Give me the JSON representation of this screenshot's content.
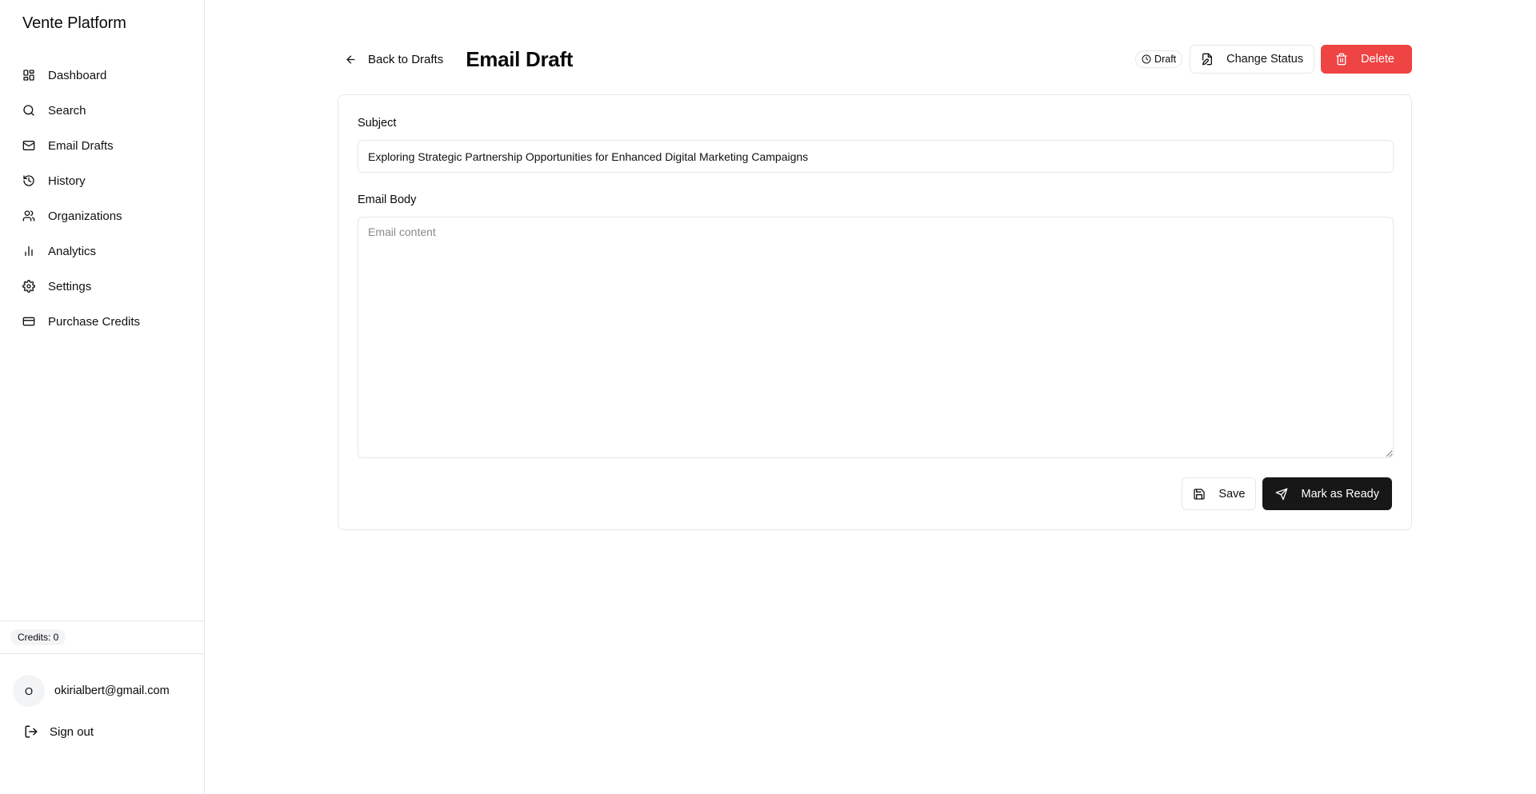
{
  "sidebar": {
    "brand": "Vente Platform",
    "items": [
      {
        "label": "Dashboard",
        "icon": "dashboard-icon"
      },
      {
        "label": "Search",
        "icon": "search-icon"
      },
      {
        "label": "Email Drafts",
        "icon": "mail-icon"
      },
      {
        "label": "History",
        "icon": "history-icon"
      },
      {
        "label": "Organizations",
        "icon": "users-icon"
      },
      {
        "label": "Analytics",
        "icon": "bar-chart-icon"
      },
      {
        "label": "Settings",
        "icon": "gear-icon"
      },
      {
        "label": "Purchase Credits",
        "icon": "credit-card-icon"
      }
    ],
    "credits": "Credits: 0",
    "user": {
      "initial": "O",
      "email": "okirialbert@gmail.com"
    },
    "signout": "Sign out"
  },
  "header": {
    "back_label": "Back to Drafts",
    "title": "Email Draft",
    "status": "Draft",
    "change_status_label": "Change Status",
    "delete_label": "Delete"
  },
  "form": {
    "subject_label": "Subject",
    "subject_value": "Exploring Strategic Partnership Opportunities for Enhanced Digital Marketing Campaigns",
    "body_label": "Email Body",
    "body_placeholder": "Email content",
    "body_value": "",
    "save_label": "Save",
    "mark_ready_label": "Mark as Ready"
  },
  "colors": {
    "danger": "#ef4444",
    "primary_dark": "#171717",
    "border": "#e5e7eb"
  }
}
